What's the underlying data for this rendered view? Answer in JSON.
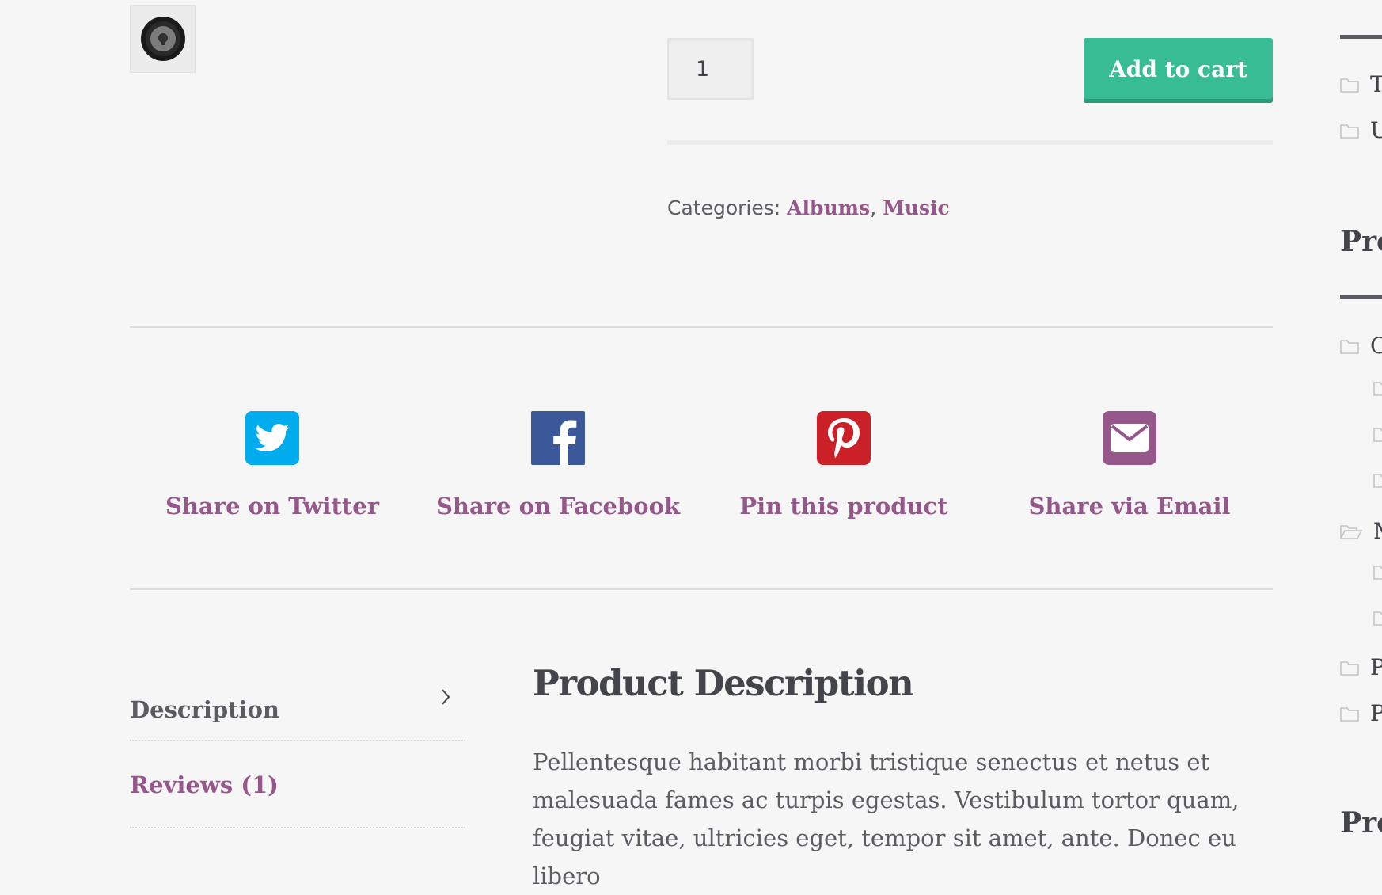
{
  "product": {
    "thumbnail_icon": "vinyl-record-icon",
    "quantity": "1",
    "add_to_cart_label": "Add to cart",
    "categories_prefix": "Categories: ",
    "categories": [
      "Albums",
      "Music"
    ],
    "category_separator": ", "
  },
  "share": {
    "items": [
      {
        "label": "Share on Twitter",
        "icon": "twitter-icon",
        "color": "#00aced"
      },
      {
        "label": "Share on Facebook",
        "icon": "facebook-icon",
        "color": "#3b5998"
      },
      {
        "label": "Pin this product",
        "icon": "pinterest-icon",
        "color": "#cb2027"
      },
      {
        "label": "Share via Email",
        "icon": "email-icon",
        "color": "#96588a"
      }
    ]
  },
  "tabs": {
    "description_label": "Description",
    "reviews_label": "Reviews (1)"
  },
  "description": {
    "heading": "Product Description",
    "text": "Pellentesque habitant morbi tristique senectus et netus et malesuada fames ac turpis egestas. Vestibulum tortor quam, feugiat vitae, ultricies eget, tempor sit amet, ante. Donec eu libero"
  },
  "sidebar": {
    "top_items": [
      "T",
      "U"
    ],
    "heading_1": "Pro",
    "items": [
      "C",
      "",
      "",
      "",
      "M",
      "",
      "",
      "P",
      "P"
    ],
    "heading_2": "Pro"
  },
  "colors": {
    "accent": "#96588a",
    "button": "#37bc94",
    "background": "#f6f6f6"
  }
}
